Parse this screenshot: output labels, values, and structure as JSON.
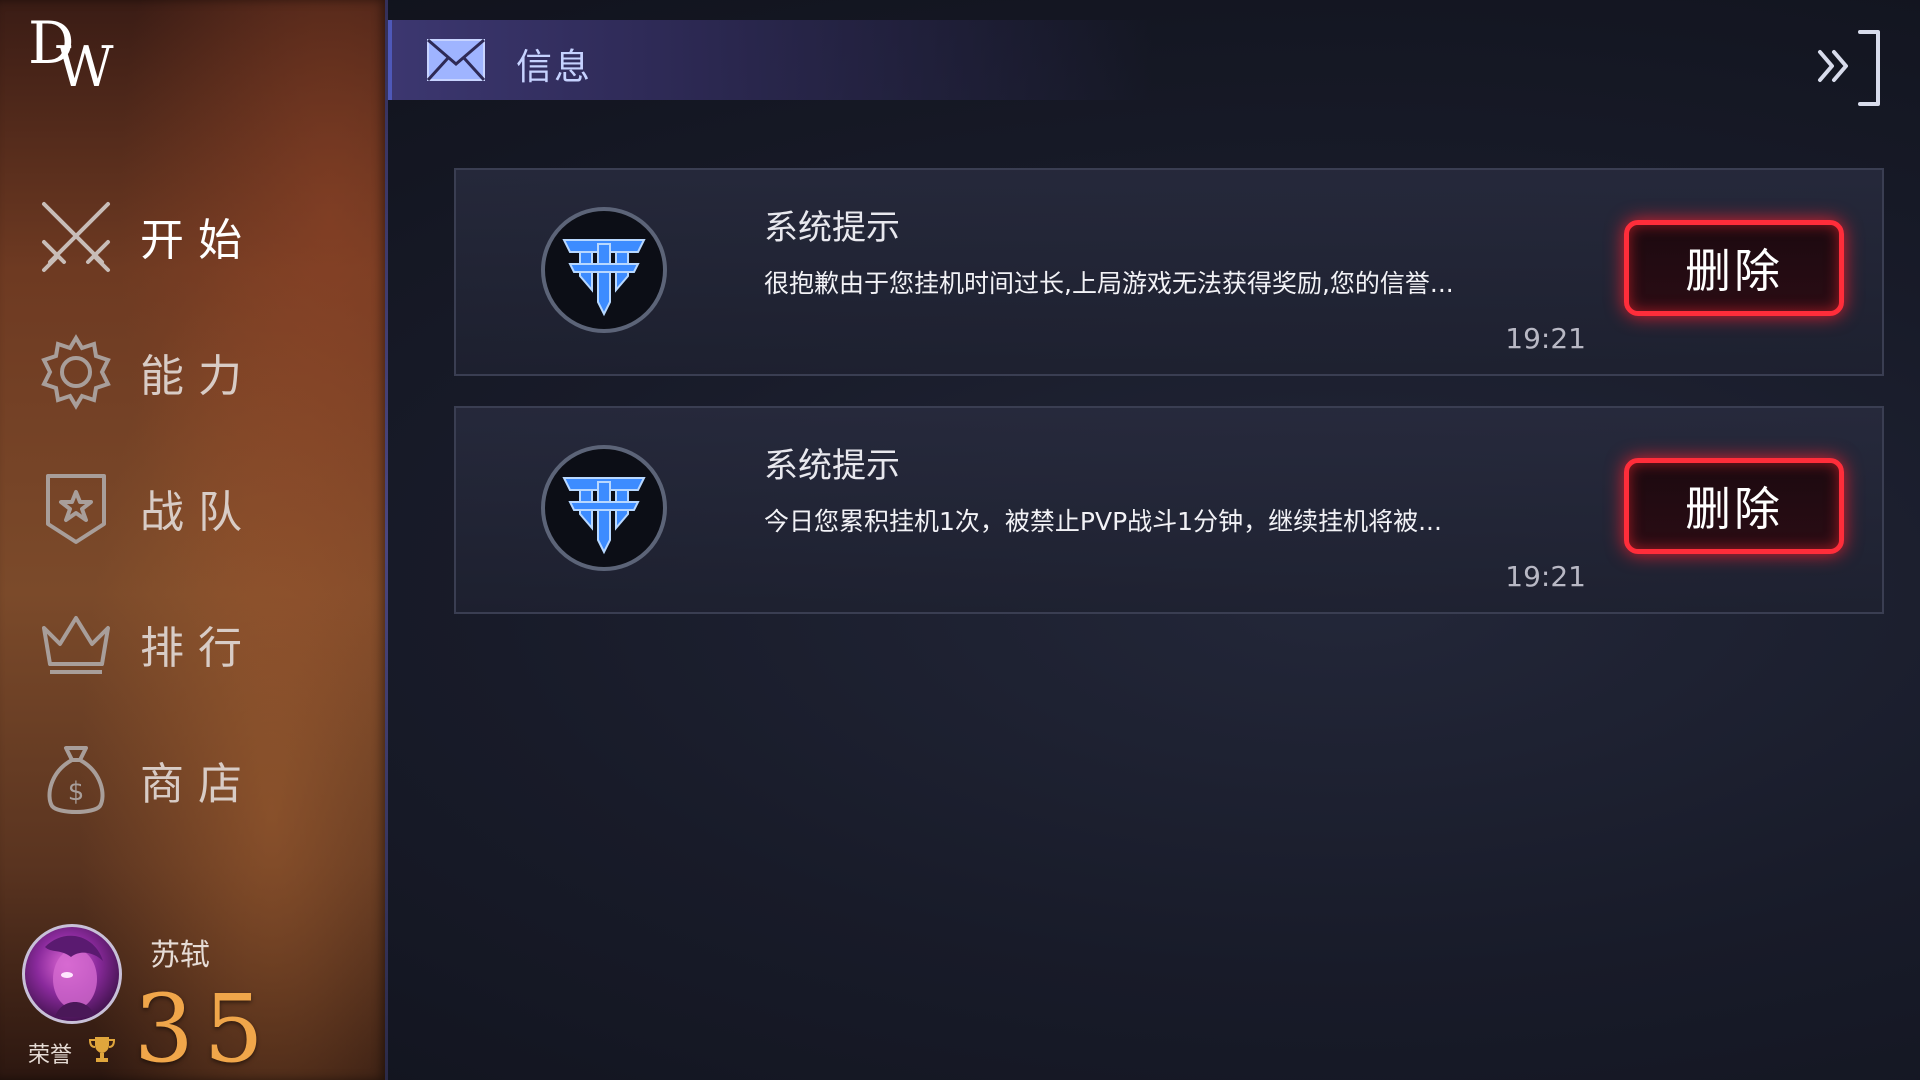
{
  "app": {
    "logo_text": "DW"
  },
  "sidebar": {
    "items": [
      {
        "label": "开始",
        "icon": "crossed-swords-icon",
        "active": true
      },
      {
        "label": "能力",
        "icon": "gear-icon",
        "active": false
      },
      {
        "label": "战队",
        "icon": "shield-star-icon",
        "active": false
      },
      {
        "label": "排行",
        "icon": "crown-icon",
        "active": false
      },
      {
        "label": "商店",
        "icon": "money-bag-icon",
        "active": false
      }
    ]
  },
  "profile": {
    "name": "苏轼",
    "honor_label": "荣誉",
    "honor_value": "35",
    "honor_icon": "trophy-icon"
  },
  "header": {
    "title": "信息",
    "icon": "mail-icon",
    "close_icon": "collapse-panel-icon"
  },
  "messages": [
    {
      "title": "系统提示",
      "body": "很抱歉由于您挂机时间过长,上局游戏无法获得奖励,您的信誉...",
      "time": "19:21",
      "delete_label": "删除"
    },
    {
      "title": "系统提示",
      "body": "今日您累积挂机1次，被禁止PVP战斗1分钟，继续挂机将被...",
      "time": "19:21",
      "delete_label": "删除"
    }
  ],
  "colors": {
    "accent_red": "#ff2d3a",
    "honor_gold": "#f0a64a",
    "header_blue": "#4e58b8"
  }
}
